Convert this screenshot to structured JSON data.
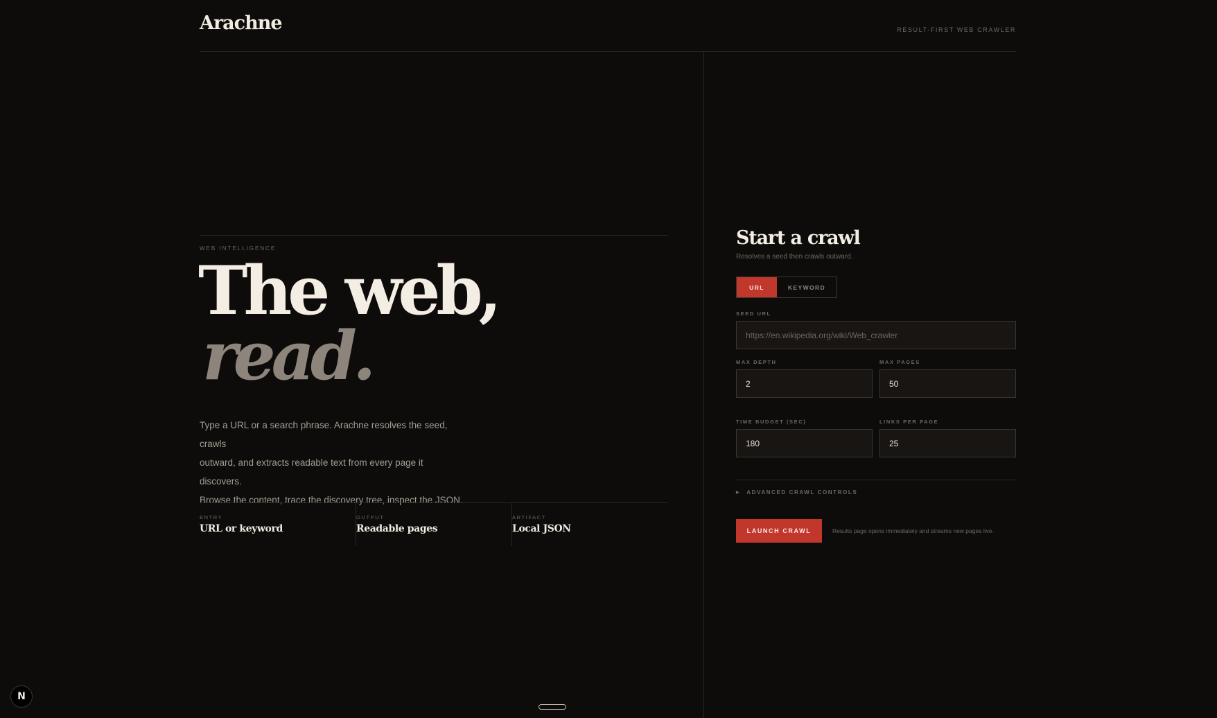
{
  "header": {
    "brand": "Arachne",
    "tagline": "RESULT-FIRST WEB CRAWLER"
  },
  "hero": {
    "eyebrow": "WEB INTELLIGENCE",
    "headline_line1": "The web,",
    "headline_line2": "read.",
    "lede_lines": [
      "Type a URL or a search phrase. Arachne resolves the seed, crawls",
      "outward, and extracts readable text from every page it discovers.",
      "Browse the content, trace the discovery tree, inspect the JSON."
    ],
    "facts": [
      {
        "label": "ENTRY",
        "value": "URL or keyword"
      },
      {
        "label": "OUTPUT",
        "value": "Readable pages"
      },
      {
        "label": "ARTIFACT",
        "value": "Local JSON"
      }
    ]
  },
  "form": {
    "title": "Start a crawl",
    "subtitle": "Resolves a seed then crawls outward.",
    "modes": [
      {
        "label": "URL",
        "active": true
      },
      {
        "label": "KEYWORD",
        "active": false
      }
    ],
    "seed_url": {
      "label": "SEED URL",
      "placeholder": "https://en.wikipedia.org/wiki/Web_crawler",
      "value": ""
    },
    "max_depth": {
      "label": "MAX DEPTH",
      "value": "2"
    },
    "max_pages": {
      "label": "MAX PAGES",
      "value": "50"
    },
    "time_budget": {
      "label": "TIME BUDGET (SEC)",
      "value": "180"
    },
    "links_per_page": {
      "label": "LINKS PER PAGE",
      "value": "25"
    },
    "advanced_label": "ADVANCED CRAWL CONTROLS",
    "launch_label": "LAUNCH CRAWL",
    "launch_note": "Results page opens immediately and streams new pages live."
  },
  "badge": {
    "letter": "N"
  },
  "colors": {
    "background": "#0e0c0b",
    "accent": "#c1372c",
    "text": "#f3ede3",
    "muted": "#6d665f"
  }
}
